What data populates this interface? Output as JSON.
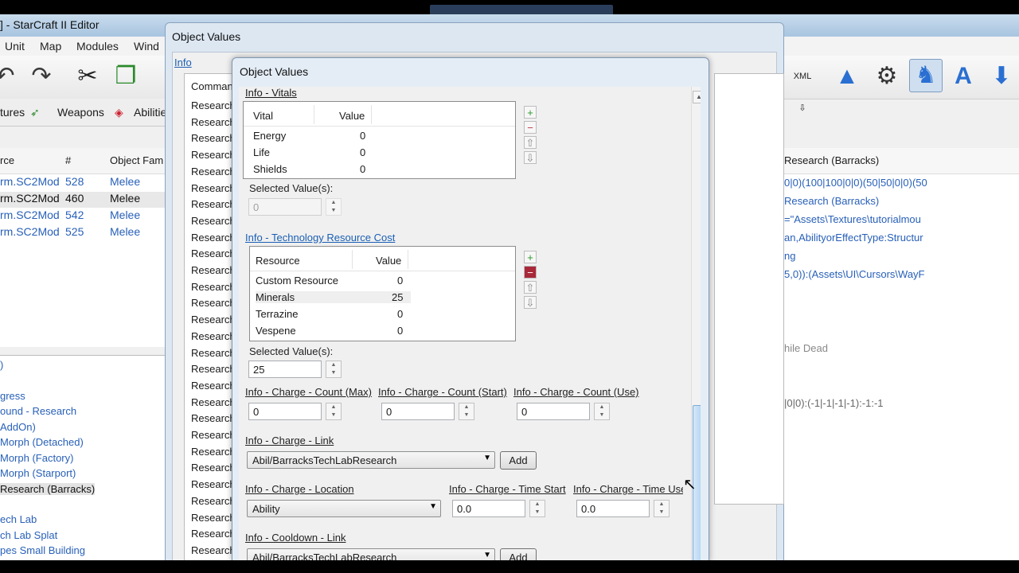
{
  "editor": {
    "title": "] - StarCraft II Editor",
    "menu": [
      "Unit",
      "Map",
      "Modules",
      "Wind"
    ],
    "toolbar_icons": [
      "undo-icon",
      "redo-icon",
      "cut-icon",
      "copy-icon",
      "xml-icon",
      "terrain-icon",
      "settings-icon",
      "unit-icon",
      "text-icon",
      "import-icon"
    ],
    "tabs": [
      "tures",
      "Weapons",
      "Abilitie"
    ],
    "list_headers": {
      "source": "rce",
      "num": "#",
      "family": "Object Fam"
    },
    "list_rows": [
      {
        "source": "rm.SC2Mod",
        "num": "528",
        "family": "Melee"
      },
      {
        "source": "rm.SC2Mod",
        "num": "460",
        "family": "Melee"
      },
      {
        "source": "rm.SC2Mod",
        "num": "542",
        "family": "Melee"
      },
      {
        "source": "rm.SC2Mod",
        "num": "525",
        "family": "Melee"
      }
    ],
    "tree_items": [
      ")",
      "gress",
      "ound - Research",
      "AddOn)",
      "Morph (Detached)",
      "Morph (Factory)",
      "Morph (Starport)",
      "Research (Barracks)",
      "ech Lab",
      "ch Lab Splat",
      "pes Small Building"
    ],
    "right_header": "Research (Barracks)",
    "right_lines": [
      "0|0)(100|100|0|0)(50|50|0|0)(50",
      "Research (Barracks)",
      "=\"Assets\\Textures\\tutorialmou",
      "an,AbilityorEffectType:Structur",
      "ng",
      "5,0)):(Assets\\UI\\Cursors\\WayF",
      "hile Dead",
      "|0|0):(-1|-1|-1|-1):-1:-1"
    ]
  },
  "back_dialog": {
    "title": "Object Values",
    "info_link": "Info",
    "command_header": "Command",
    "command_rows": [
      "Research",
      "Research",
      "Research",
      "Research",
      "Research",
      "Research",
      "Research",
      "Research",
      "Research",
      "Research",
      "Research",
      "Research",
      "Research",
      "Research",
      "Research",
      "Research",
      "Research",
      "Research",
      "Research",
      "Research",
      "Research",
      "Research",
      "Research",
      "Research",
      "Research",
      "Research",
      "Research",
      "Research",
      "Research"
    ]
  },
  "front_dialog": {
    "title": "Object Values",
    "vitals": {
      "link": "Info - Vitals",
      "col_name": "Vital",
      "col_value": "Value",
      "rows": [
        {
          "name": "Energy",
          "value": "0"
        },
        {
          "name": "Life",
          "value": "0"
        },
        {
          "name": "Shields",
          "value": "0"
        }
      ],
      "selected_label": "Selected Value(s):",
      "selected_value": "0"
    },
    "resource_cost": {
      "link": "Info - Technology Resource Cost",
      "col_name": "Resource",
      "col_value": "Value",
      "rows": [
        {
          "name": "Custom Resource",
          "value": "0"
        },
        {
          "name": "Minerals",
          "value": "25"
        },
        {
          "name": "Terrazine",
          "value": "0"
        },
        {
          "name": "Vespene",
          "value": "0"
        }
      ],
      "selected_label": "Selected Value(s):",
      "selected_value": "25"
    },
    "charge_count_max": {
      "label": "Info - Charge - Count (Max)",
      "value": "0"
    },
    "charge_count_start": {
      "label": "Info - Charge - Count (Start)",
      "value": "0"
    },
    "charge_count_use": {
      "label": "Info - Charge - Count (Use)",
      "value": "0"
    },
    "charge_link": {
      "label": "Info - Charge - Link",
      "value": "Abil/BarracksTechLabResearch",
      "add": "Add"
    },
    "charge_location": {
      "label": "Info - Charge - Location",
      "value": "Ability"
    },
    "charge_time_start": {
      "label": "Info - Charge - Time Start",
      "value": "0.0"
    },
    "charge_time_use": {
      "label": "Info - Charge - Time Use",
      "value": "0.0"
    },
    "cooldown_link": {
      "label": "Info - Cooldown - Link",
      "value": "Abil/BarracksTechLabResearch",
      "add": "Add"
    }
  }
}
